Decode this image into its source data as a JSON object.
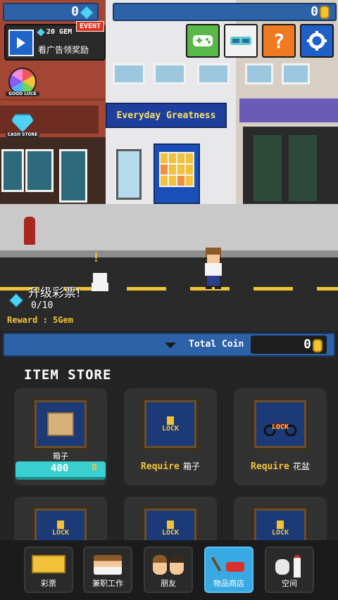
{
  "top": {
    "gem_count": "0",
    "coin_count": "0",
    "ad_gem_label": "20 GEM",
    "event_badge": "EVENT",
    "ad_label": "看广告领奖励",
    "good_luck_label": "GOOD LUCK",
    "cash_store_label": "CASH STORE"
  },
  "scene": {
    "shop_sign": "Everyday Greatness",
    "exclaim": "!"
  },
  "lottery": {
    "title": "升级彩票!",
    "progress": "0/10",
    "reward": "Reward : 5Gem"
  },
  "coinbar": {
    "label": "Total Coin",
    "value": "0"
  },
  "store": {
    "title": "ITEM STORE",
    "lock_label": "LOCK",
    "require_label": "Require",
    "items": [
      {
        "name": "箱子",
        "price": "400",
        "coin_mark": "0"
      },
      {
        "require_item": "箱子"
      },
      {
        "require_item": "花盆"
      }
    ]
  },
  "nav": [
    {
      "label": "彩票"
    },
    {
      "label": "兼职工作"
    },
    {
      "label": "朋友"
    },
    {
      "label": "物品商店"
    },
    {
      "label": "空间"
    }
  ],
  "colors": {
    "accent_blue": "#2e62a8",
    "gold": "#f2c33a",
    "active_tab": "#39a9e3"
  }
}
